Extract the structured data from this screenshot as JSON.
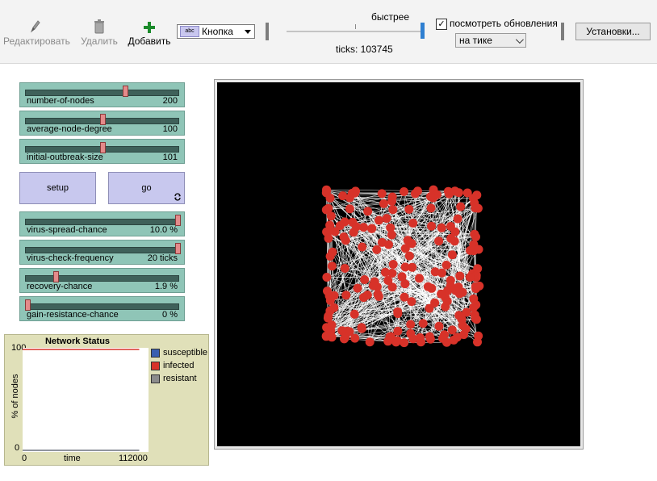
{
  "toolbar": {
    "edit_label": "Редактировать",
    "delete_label": "Удалить",
    "add_label": "Добавить",
    "widget_type": "Кнопка",
    "widget_icon_text": "abc",
    "speed_label": "быстрее",
    "ticks_text": "ticks: 103745",
    "view_updates_label": "посмотреть обновления",
    "view_updates_checked": true,
    "update_mode": "на тике",
    "settings_label": "Установки..."
  },
  "sliders": [
    {
      "name": "number-of-nodes",
      "value": "200",
      "fraction": 0.65
    },
    {
      "name": "average-node-degree",
      "value": "100",
      "fraction": 0.5
    },
    {
      "name": "initial-outbreak-size",
      "value": "101",
      "fraction": 0.5
    },
    {
      "name": "virus-spread-chance",
      "value": "10.0 %",
      "fraction": 1.0
    },
    {
      "name": "virus-check-frequency",
      "value": "20 ticks",
      "fraction": 1.0
    },
    {
      "name": "recovery-chance",
      "value": "1.9 %",
      "fraction": 0.19
    },
    {
      "name": "gain-resistance-chance",
      "value": "0 %",
      "fraction": 0.0
    }
  ],
  "buttons": {
    "setup_label": "setup",
    "go_label": "go",
    "go_forever_icon": "loop-arrows-icon"
  },
  "plot": {
    "title": "Network Status",
    "ylabel": "% of nodes",
    "xlabel": "time",
    "y_max_label": "100",
    "y_min_label": "0",
    "x_min_label": "0",
    "x_max_label": "112000",
    "legend": [
      {
        "name": "susceptible",
        "color": "#3a5fb0"
      },
      {
        "name": "infected",
        "color": "#d73229"
      },
      {
        "name": "resistant",
        "color": "#8c8c8c"
      }
    ]
  },
  "chart_data": {
    "type": "line",
    "title": "Network Status",
    "xlabel": "time",
    "ylabel": "% of nodes",
    "xlim": [
      0,
      112000
    ],
    "ylim": [
      0,
      100
    ],
    "series": [
      {
        "name": "susceptible",
        "color": "#3a5fb0",
        "x": [
          0,
          103745
        ],
        "values": [
          0,
          0
        ]
      },
      {
        "name": "infected",
        "color": "#d73229",
        "x": [
          0,
          103745
        ],
        "values": [
          100,
          100
        ]
      },
      {
        "name": "resistant",
        "color": "#8c8c8c",
        "x": [
          0,
          103745
        ],
        "values": [
          0,
          0
        ]
      }
    ]
  },
  "world": {
    "background": "#000000",
    "node_color": "#d73229",
    "link_color": "#ffffff",
    "node_count": 200
  }
}
